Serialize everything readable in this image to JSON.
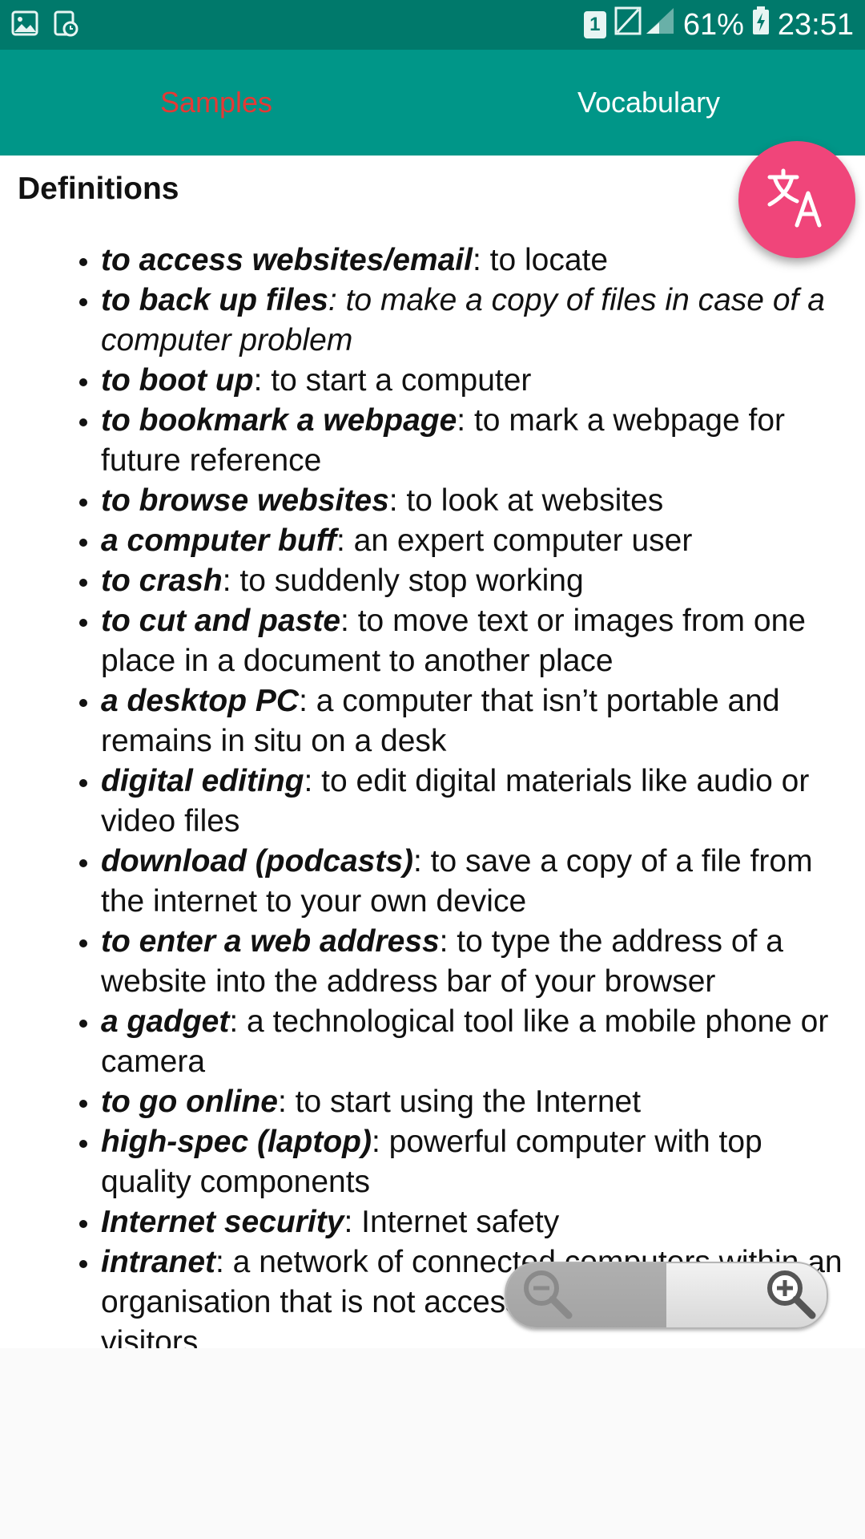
{
  "status_bar": {
    "sim_badge": "1",
    "battery": "61%",
    "time": "23:51",
    "icons": [
      "gallery-icon",
      "scheduled-notification-icon",
      "sim-icon",
      "signal-icon",
      "battery-charging-icon"
    ]
  },
  "tabs": [
    {
      "label": "Samples",
      "selected": true
    },
    {
      "label": "Vocabulary",
      "selected": false
    }
  ],
  "colors": {
    "status_bar": "#00796b",
    "app_bar": "#009688",
    "selected_tab_text": "#e53935",
    "fab": "#f0457a"
  },
  "fab": {
    "icon": "translate-icon"
  },
  "content": {
    "heading": "Definitions",
    "items": [
      {
        "term": "to access websites/email",
        "definition": ": to locate"
      },
      {
        "term": "to back up files",
        "definition": ": to make a copy of files in case of a computer problem"
      },
      {
        "term": "to boot up",
        "definition": ": to start a computer"
      },
      {
        "term": "to bookmark a webpage",
        "definition": ": to mark a webpage for future reference"
      },
      {
        "term": "to browse websites",
        "definition": ": to look at websites"
      },
      {
        "term": "a computer buff",
        "definition": ": an expert computer user"
      },
      {
        "term": "to crash",
        "definition": ": to suddenly stop working"
      },
      {
        "term": "to cut and paste",
        "definition": ": to move text or images from one place in a document to another place"
      },
      {
        "term": "a desktop PC",
        "definition": ": a computer that isn’t portable and remains in situ on a desk"
      },
      {
        "term": "digital editing",
        "definition": ": to edit digital materials like audio or video files"
      },
      {
        "term": "download (podcasts)",
        "definition": ": to save a copy of a file from the internet to your own device"
      },
      {
        "term": "to enter a web address",
        "definition": ": to type the address of a website into the address bar of your browser"
      },
      {
        "term": "a gadget",
        "definition": ": a technological tool like a mobile phone or camera"
      },
      {
        "term": "to go online",
        "definition": ": to start using the Internet"
      },
      {
        "term": "high-spec (laptop)",
        "definition": ": powerful computer with top quality components"
      },
      {
        "term": "Internet security",
        "definition": ": Internet safety"
      },
      {
        "term": "intranet",
        "definition": ": a network of connected computers within an organisation that is not accessible by unauthorised visitors"
      }
    ]
  },
  "zoom_control": {
    "zoom_out_icon": "zoom-out-icon",
    "zoom_in_icon": "zoom-in-icon"
  }
}
